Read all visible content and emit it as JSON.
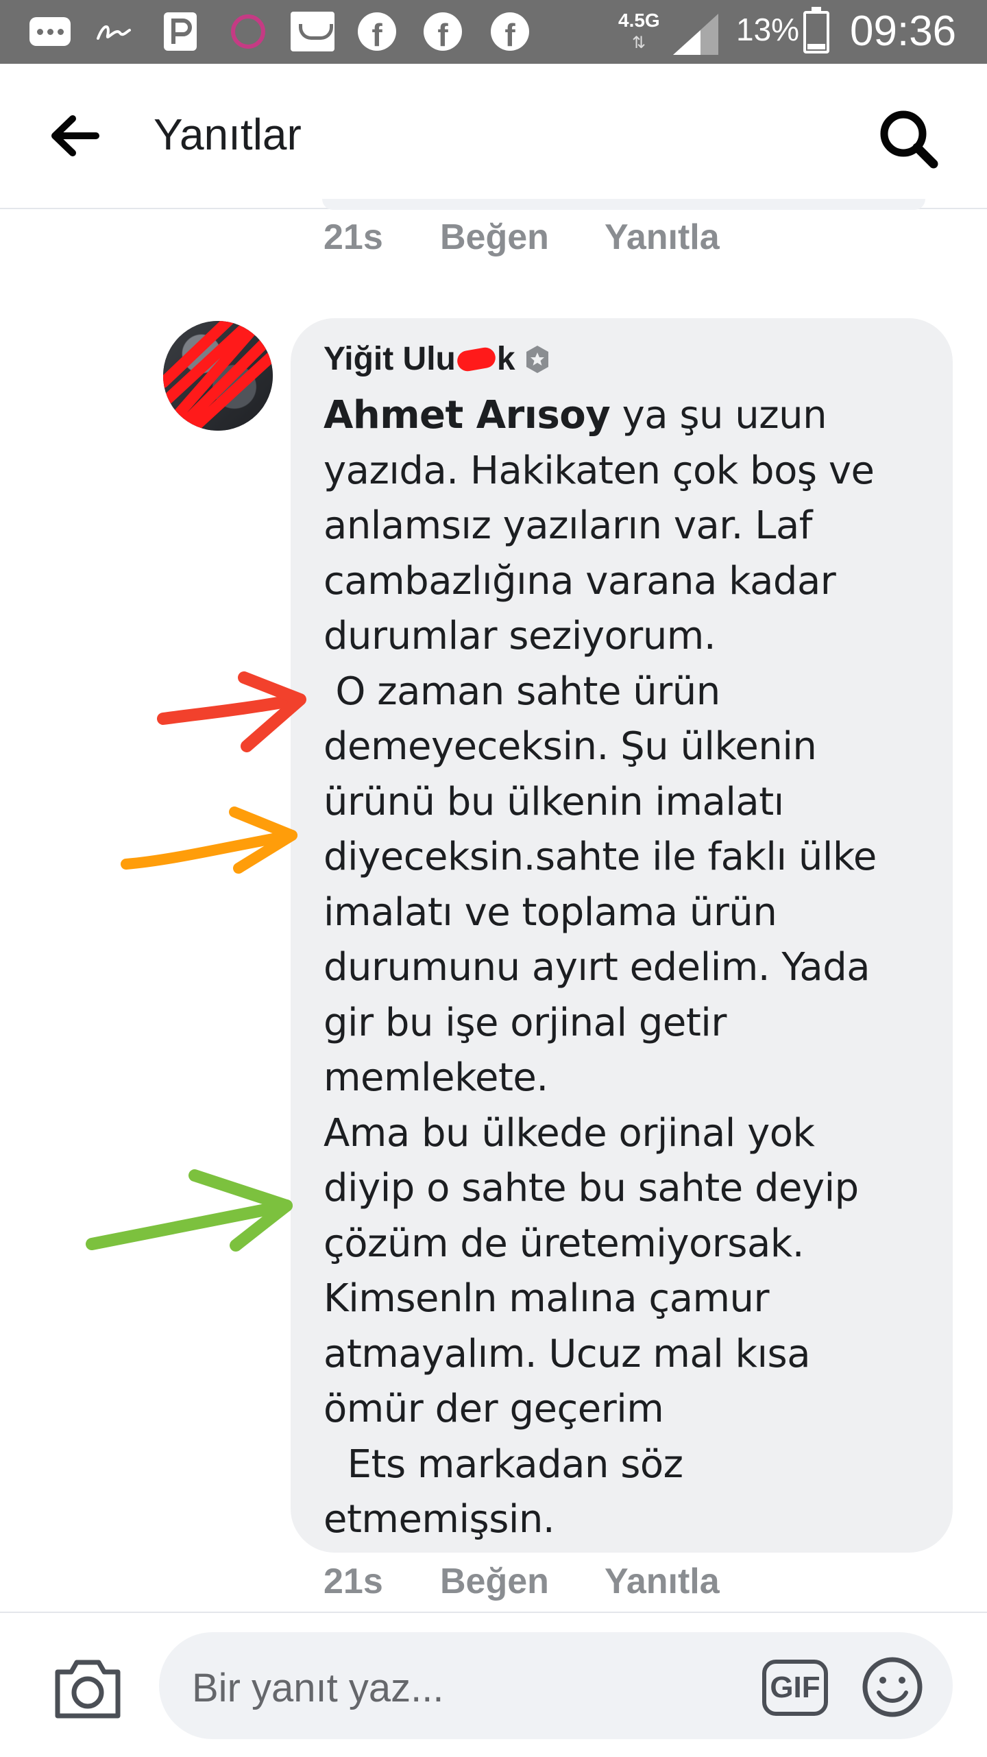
{
  "status_bar": {
    "network": "4.5G",
    "battery": "13%",
    "time": "09:36",
    "notification_icons": [
      "message-icon",
      "signature-icon",
      "p-app-icon",
      "circle-app-icon",
      "inbox-icon",
      "facebook-icon",
      "facebook-icon",
      "facebook-icon"
    ]
  },
  "header": {
    "title": "Yanıtlar"
  },
  "previous_reply_actions": {
    "time": "21s",
    "like": "Beğen",
    "reply": "Yanıtla"
  },
  "comment": {
    "author": "Yiğit Ulu",
    "author_tail": "k",
    "mention": "Ahmet Arısoy",
    "text": " ya şu uzun\nyazıda. Hakikaten çok boş ve\nanlamsız yazıların var. Laf\ncambazlığına varana kadar\ndurumlar seziyorum.\n O zaman sahte ürün\ndemeyeceksin. Şu ülkenin\nürünü bu ülkenin imalatı\ndiyeceksin.sahte ile faklı ülke\nimalatı ve toplama ürün\ndurumunu ayırt edelim. Yada\ngir bu işe orjinal getir\nmemlekete.\nAma bu ülkede orjinal yok\ndiyip o sahte bu sahte deyip\nçözüm de üretemiyorsak.\nKimsenln malına çamur\natmayalım. Ucuz mal kısa\nömür der geçerim\n  Ets markadan söz\netmemişsin.",
    "time": "21s",
    "like": "Beğen",
    "reply": "Yanıtla"
  },
  "annotations": {
    "arrow_colors": [
      "#f2412c",
      "#ff9d0a",
      "#7cc13e"
    ],
    "scribble_color": "#ff1a1a"
  },
  "composer": {
    "placeholder": "Bir yanıt yaz...",
    "gif_label": "GIF"
  },
  "colors": {
    "status_bar": "#6f6f6f",
    "bubble": "#eff0f2",
    "meta_text": "#8a8d91"
  }
}
